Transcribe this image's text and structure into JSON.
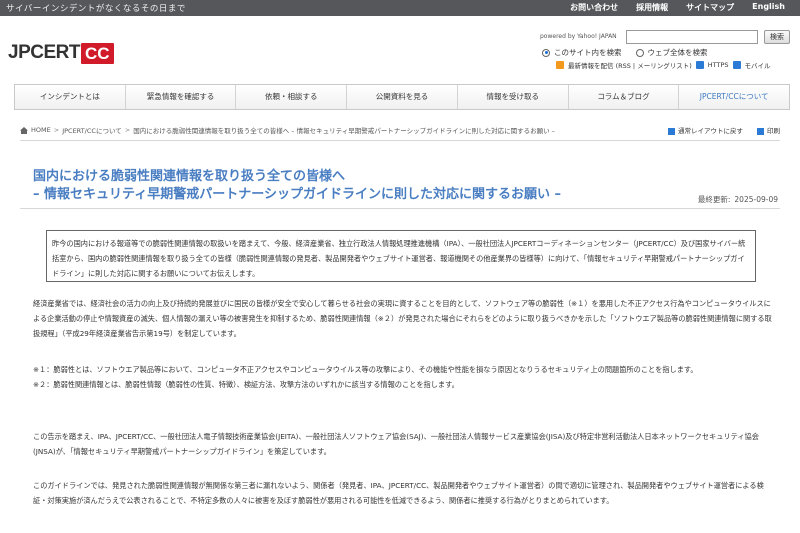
{
  "topbar": {
    "slogan": "サイバーインシデントがなくなるその日まで",
    "links": [
      "お問い合わせ",
      "採用情報",
      "サイトマップ",
      "English"
    ]
  },
  "logo": {
    "text_left": "JPCERT",
    "text_right": "CC"
  },
  "search": {
    "powered_by": "powered by Yahoo! JAPAN",
    "value": "",
    "button": "検索",
    "option_site": "このサイト内を検索",
    "option_web": "ウェブ全体を検索",
    "rss": "最新情報を配信 (RSS | メーリングリスト)",
    "https": "HTTPS",
    "mobile": "モバイル"
  },
  "nav": {
    "items": [
      "インシデントとは",
      "緊急情報を確認する",
      "依頼・相談する",
      "公開資料を見る",
      "情報を受け取る",
      "コラム＆ブログ",
      "JPCERT/CCについて"
    ]
  },
  "breadcrumb": {
    "home": "HOME",
    "l1": "JPCERT/CCについて",
    "current": "国内における脆弱性関連情報を取り扱う全ての皆様へ – 情報セキュリティ早期警戒パートナーシップガイドラインに則した対応に関するお願い –"
  },
  "util": {
    "print_layout": "通常レイアウトに戻す",
    "print": "印刷"
  },
  "page": {
    "title_line1": "国内における脆弱性関連情報を取り扱う全ての皆様へ",
    "title_line2": "– 情報セキュリティ早期警戒パートナーシップガイドラインに則した対応に関するお願い –",
    "updated_label": "最終更新:",
    "updated_value": "2025-09-09"
  },
  "intro": "昨今の国内における報道等での脆弱性関連情報の取扱いを踏まえて、今般、経済産業省、独立行政法人情報処理推進機構（IPA）、一般社団法人JPCERTコーディネーションセンター（JPCERT/CC）及び国家サイバー統括室から、国内の脆弱性関連情報を取り扱う全ての皆様（脆弱性関連情報の発見者、製品開発者やウェブサイト運営者、報道機関その他産業界の皆様等）に向けて、「情報セキュリティ早期警戒パートナーシップガイドライン」に則した対応に関するお願いについてお伝えします。",
  "paragraphs": {
    "p1": "経済産業省では、経済社会の活力の向上及び持続的発展並びに国民の皆様が安全で安心して暮らせる社会の実現に資することを目的として、ソフトウェア等の脆弱性（※１）を悪用した不正アクセス行為やコンピュータウイルスによる企業活動の停止や情報資産の滅失、個人情報の漏えい等の被害発生を抑制するため、脆弱性関連情報（※２）が発見された場合にそれらをどのように取り扱うべきかを示した「ソフトウエア製品等の脆弱性関連情報に関する取扱規程」（平成29年経済産業省告示第19号）を制定しています。",
    "note1": "※１：脆弱性とは、ソフトウエア製品等において、コンピュータ不正アクセスやコンピュータウイルス等の攻撃により、その機能や性能を損なう原因となりうるセキュリティ上の問題箇所のことを指します。",
    "note2": "※２：脆弱性関連情報とは、脆弱性情報（脆弱性の性質、特徴）、検証方法、攻撃方法のいずれかに該当する情報のことを指します。",
    "p3": "この告示を踏まえ、IPA、JPCERT/CC、一般社団法人電子情報技術産業協会(JEITA)、一般社団法人ソフトウェア協会(SAJ)、一般社団法人情報サービス産業協会(JISA)及び特定非営利活動法人日本ネットワークセキュリティ協会(JNSA)が、「情報セキュリティ早期警戒パートナーシップガイドライン」を策定しています。",
    "p4": "このガイドラインでは、発見された脆弱性関連情報が無関係な第三者に漏れないよう、関係者（発見者、IPA、JPCERT/CC、製品開発者やウェブサイト運営者）の間で適切に管理され、製品開発者やウェブサイト運営者による検証・対策実施が済んだうえで公表されることで、不特定多数の人々に被害を及ぼす脆弱性が悪用される可能性を低減できるよう、関係者に推奨する行為がとりまとめられています。"
  }
}
